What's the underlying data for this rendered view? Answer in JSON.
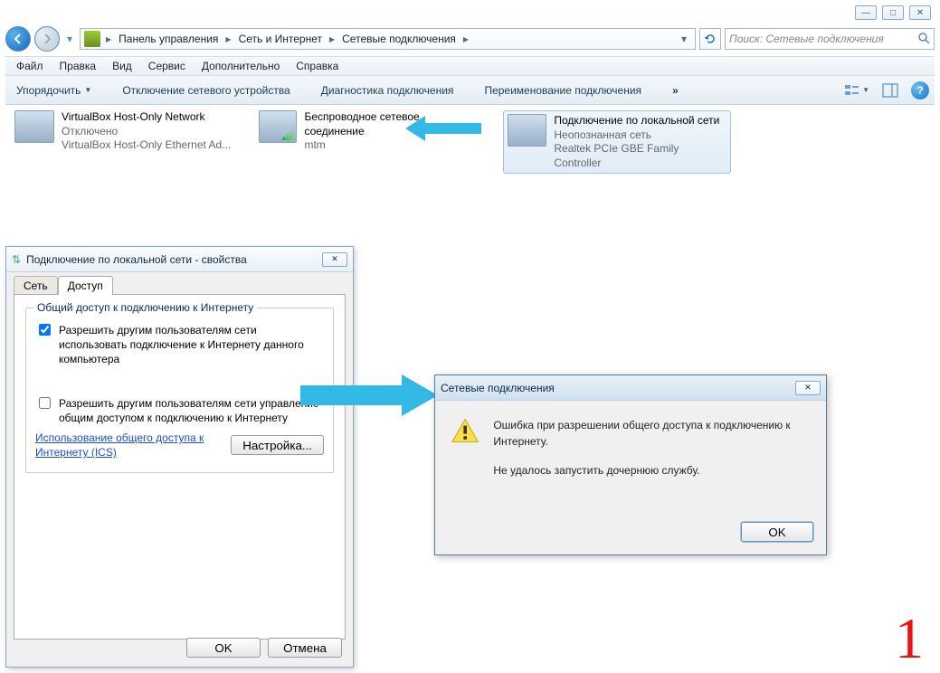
{
  "window_controls": {
    "min": "—",
    "max": "□",
    "close": "✕"
  },
  "breadcrumb": {
    "items": [
      "Панель управления",
      "Сеть и Интернет",
      "Сетевые подключения"
    ]
  },
  "search": {
    "placeholder": "Поиск: Сетевые подключения"
  },
  "menubar": [
    "Файл",
    "Правка",
    "Вид",
    "Сервис",
    "Дополнительно",
    "Справка"
  ],
  "toolbar": {
    "organize": "Упорядочить",
    "disable": "Отключение сетевого устройства",
    "diag": "Диагностика подключения",
    "rename": "Переименование подключения",
    "overflow": "»"
  },
  "connections": [
    {
      "title": "VirtualBox Host-Only Network",
      "status": "Отключено",
      "detail": "VirtualBox Host-Only Ethernet Ad..."
    },
    {
      "title": "Беспроводное сетевое соединение",
      "status": "mtm",
      "detail": ""
    },
    {
      "title": "Подключение по локальной сети",
      "status": "Неопознанная сеть",
      "detail": "Realtek PCIe GBE Family Controller"
    }
  ],
  "props_dialog": {
    "title": "Подключение по локальной сети - свойства",
    "tabs": {
      "net": "Сеть",
      "access": "Доступ"
    },
    "group_title": "Общий доступ к подключению к Интернету",
    "check1": "Разрешить другим пользователям сети использовать подключение к Интернету данного компьютера",
    "check2": "Разрешить другим пользователям сети управление общим доступом к подключению к Интернету",
    "link": "Использование общего доступа к Интернету (ICS)",
    "settings_btn": "Настройка...",
    "ok": "OK",
    "cancel": "Отмена"
  },
  "error_dialog": {
    "title": "Сетевые подключения",
    "line1": "Ошибка при разрешении общего доступа к подключению к Интернету.",
    "line2": "Не удалось запустить дочернюю службу.",
    "ok": "OK"
  },
  "big_number": "1"
}
